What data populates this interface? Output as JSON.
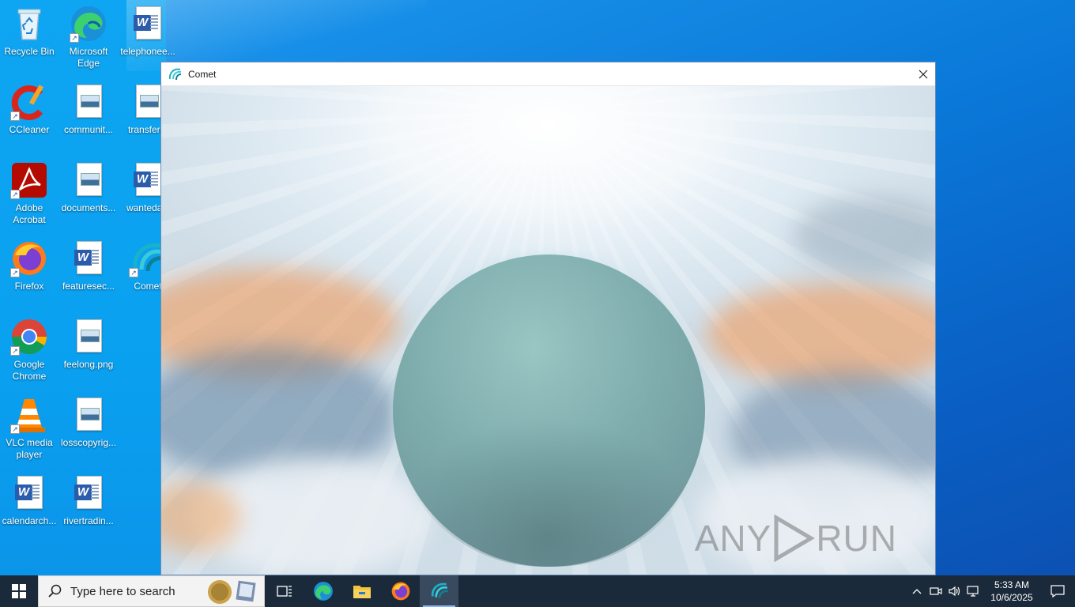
{
  "desktop": {
    "icons": [
      {
        "label": "Recycle Bin"
      },
      {
        "label": "Microsoft Edge"
      },
      {
        "label": "telephonee..."
      },
      {
        "label": "CCleaner"
      },
      {
        "label": "communit..."
      },
      {
        "label": "transferal"
      },
      {
        "label": "Adobe Acrobat"
      },
      {
        "label": "documents..."
      },
      {
        "label": "wantedals"
      },
      {
        "label": "Firefox"
      },
      {
        "label": "featuresec..."
      },
      {
        "label": "Comet"
      },
      {
        "label": "Google Chrome"
      },
      {
        "label": "feelong.png"
      },
      {
        "label": "VLC media player"
      },
      {
        "label": "losscopyrig..."
      },
      {
        "label": "calendarch..."
      },
      {
        "label": "rivertradin..."
      }
    ]
  },
  "window": {
    "title": "Comet",
    "icon": "comet-logo-icon",
    "close_icon": "close-icon"
  },
  "watermark": {
    "text_left": "ANY",
    "text_right": "RUN"
  },
  "taskbar": {
    "search_placeholder": "Type here to search",
    "pinned": [
      "task-view-icon",
      "edge-icon",
      "file-explorer-icon",
      "firefox-icon",
      "comet-icon"
    ],
    "active": "comet-icon",
    "clock_time": "5:33 AM",
    "clock_date": "10/6/2025"
  },
  "colors": {
    "accent": "#0a78d8",
    "taskbar": "#1b2a3a"
  }
}
